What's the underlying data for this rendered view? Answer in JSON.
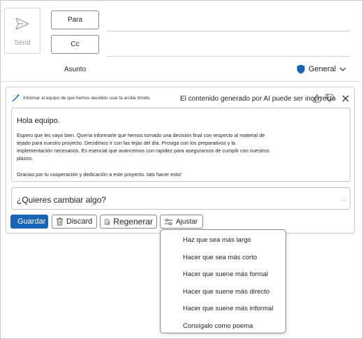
{
  "header": {
    "send_label": "Send",
    "to_label": "Para",
    "cc_label": "Cc",
    "subject_label": "Asunto",
    "sensitivity_label": "General",
    "sensitivity_color": "#1a64b8"
  },
  "copilot": {
    "prompt_text": "Informar al equipo de que hemos decidido usar la arcilla tímida",
    "disclaimer": "El contenido generado por AI puede ser incorrecto",
    "draft": {
      "greeting": "Hola equipo.",
      "lines": [
        "Espero que les vaya bien. Quería informarle que hemos tomado una decisión final con respecto al material de",
        "tejado para nuestro proyecto. Decidimos ir con las tejas del día. Prosiga con los preparativos y la",
        "implementación necesarios. Es esencial que avancemos con rapidez para asegurarnos de cumplir con nuestros",
        "plazos.",
        "Gracias por tu cooperación y dedicación a este proyecto. tats hacer esto!"
      ]
    },
    "refine_placeholder": "¿Quieres cambiar algo?",
    "buttons": {
      "keep": "Guardar",
      "discard": "Discard",
      "regenerate": "Regenerar",
      "adjust": "Ajustar"
    },
    "adjust_menu": [
      "Haz que sea más largo",
      "Hacer que sea más corto",
      "Hacer que suene más formal",
      "Hacer que suene más directo",
      "Hacer que suene más informal",
      "Consígalo como poema"
    ]
  },
  "colors": {
    "accent": "#1a64b8"
  }
}
